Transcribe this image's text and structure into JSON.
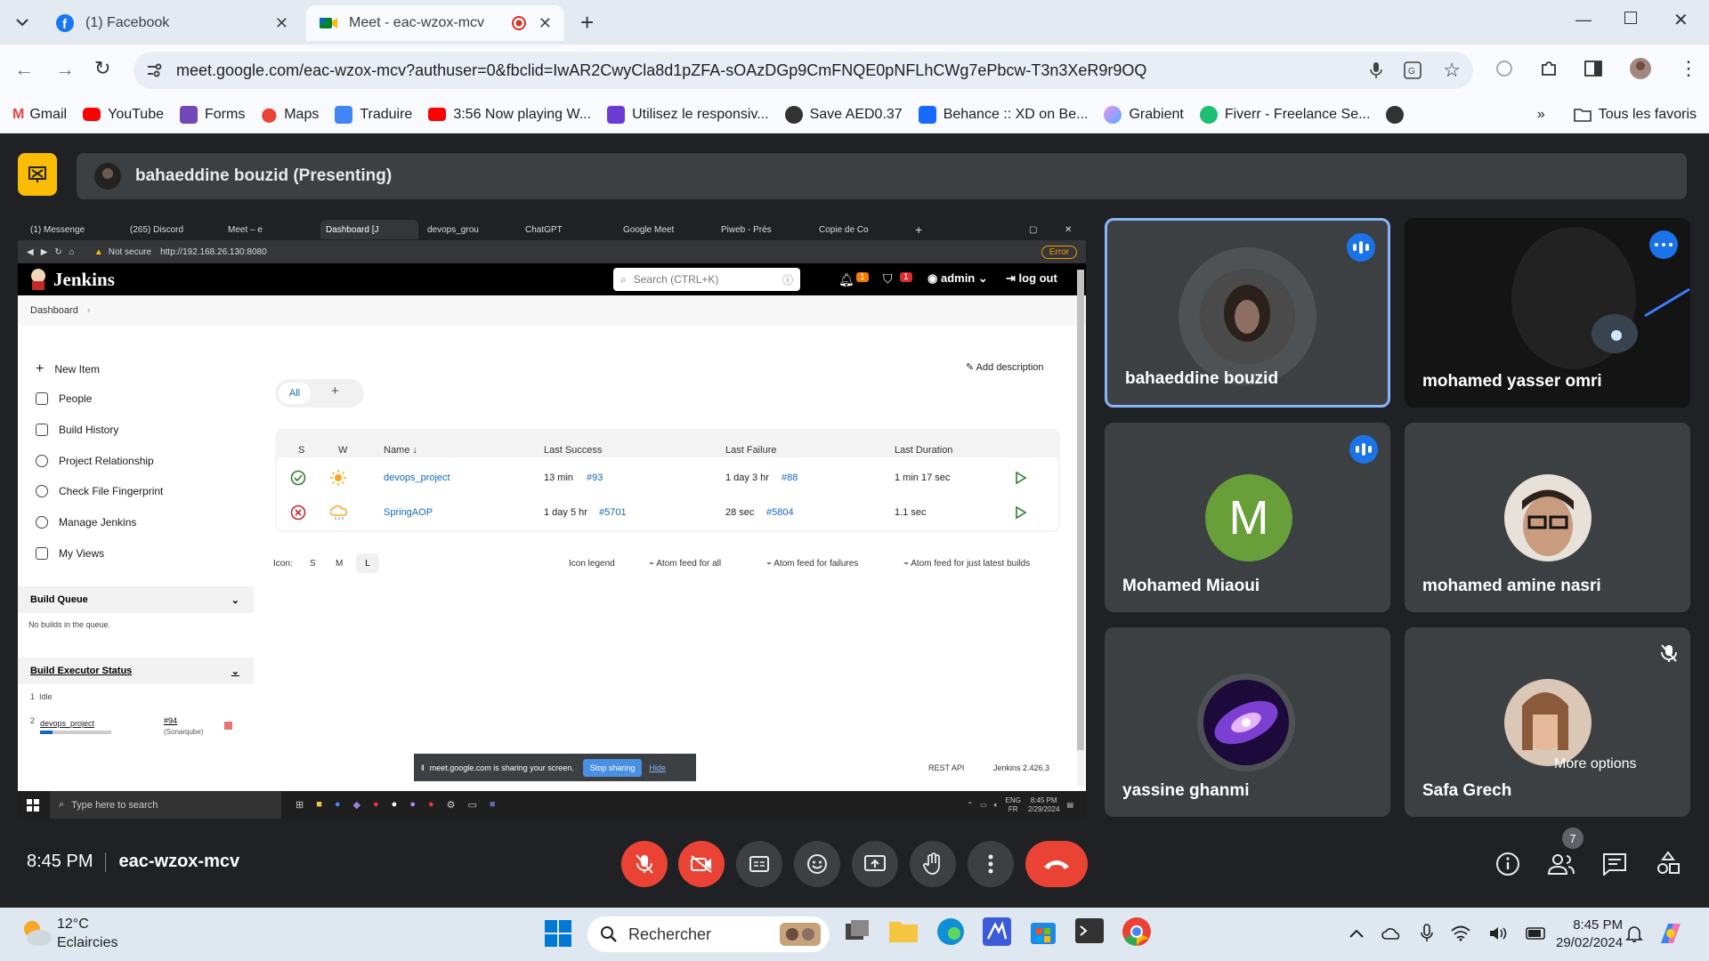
{
  "browser": {
    "tabs": [
      {
        "label": "(1) Facebook",
        "active": false
      },
      {
        "label": "Meet - eac-wzox-mcv",
        "active": true
      }
    ],
    "url": "meet.google.com/eac-wzox-mcv?authuser=0&fbclid=IwAR2CwyCla8d1pZFA-sOAzDGp9CmFNQE0pNFLhCWg7ePbcw-T3n3XeR9r9OQ",
    "bookmarks": [
      "Gmail",
      "YouTube",
      "Forms",
      "Maps",
      "Traduire",
      "3:56 Now playing W...",
      "Utilisez le responsiv...",
      "Save AED0.37",
      "Behance :: XD on Be...",
      "Grabient",
      "Fiverr - Freelance Se..."
    ],
    "all_bookmarks": "Tous les favoris"
  },
  "meet": {
    "presenter_label": "bahaeddine bouzid (Presenting)",
    "time": "8:45 PM",
    "meeting_code": "eac-wzox-mcv",
    "participant_count": "7",
    "participants": [
      {
        "name": "bahaeddine bouzid",
        "speaking": true
      },
      {
        "name": "mohamed yasser omri",
        "speaking": true
      },
      {
        "name": "Mohamed Miaoui",
        "initial": "M",
        "speaking": true
      },
      {
        "name": "mohamed amine nasri",
        "speaking": false
      },
      {
        "name": "yassine ghanmi",
        "speaking": false
      },
      {
        "name": "Safa Grech",
        "muted": true
      }
    ],
    "more_options": "More options",
    "accent": "#1a73e8",
    "danger": "#ea4335"
  },
  "shared": {
    "tabs": [
      "(1) Messenge",
      "(265) Discord",
      "Meet – e",
      "Dashboard [J",
      "devops_grou",
      "ChatGPT",
      "Google Meet",
      "Piweb - Prés",
      "Copie de Co"
    ],
    "not_secure": "Not secure",
    "url": "http://192.168.26.130:8080",
    "error_badge": "Error",
    "jenkins": {
      "brand": "Jenkins",
      "search_placeholder": "Search (CTRL+K)",
      "notif_count": "1",
      "security_count": "1",
      "user": "admin",
      "logout": "log out",
      "breadcrumb": "Dashboard",
      "sidebar": [
        "New Item",
        "People",
        "Build History",
        "Project Relationship",
        "Check File Fingerprint",
        "Manage Jenkins",
        "My Views"
      ],
      "build_queue_title": "Build Queue",
      "build_queue_empty": "No builds in the queue.",
      "executor_title": "Build Executor Status",
      "executor_idle": "Idle",
      "executor_idle_num": "1",
      "executor_job_num": "2",
      "executor_job": "devops_project",
      "executor_build": "#94",
      "executor_stage": "(Sonarqube)",
      "add_description": "Add description",
      "view_tab_all": "All",
      "view_tab_add": "+",
      "columns": [
        "S",
        "W",
        "Name ↓",
        "Last Success",
        "Last Failure",
        "Last Duration"
      ],
      "rows": [
        {
          "status": "success",
          "weather": "sunny",
          "name": "devops_project",
          "last_success": "13 min",
          "last_success_build": "#93",
          "last_failure": "1 day 3 hr",
          "last_failure_build": "#88",
          "duration": "1 min 17 sec"
        },
        {
          "status": "failed",
          "weather": "cloudy",
          "name": "SpringAOP",
          "last_success": "1 day 5 hr",
          "last_success_build": "#5701",
          "last_failure": "28 sec",
          "last_failure_build": "#5804",
          "duration": "1.1 sec"
        }
      ],
      "icon_label": "Icon:",
      "icon_sizes": [
        "S",
        "M",
        "L"
      ],
      "icon_legend": "Icon legend",
      "feeds": [
        "Atom feed for all",
        "Atom feed for failures",
        "Atom feed for just latest builds"
      ],
      "sharing_text": "meet.google.com is sharing your screen.",
      "stop_sharing": "Stop sharing",
      "hide": "Hide",
      "rest_api": "REST API",
      "version": "Jenkins 2.426.3"
    },
    "taskbar": {
      "search": "Type here to search",
      "lang": "ENG",
      "lang2": "FR",
      "time": "8:45 PM",
      "date": "2/29/2024"
    }
  },
  "windows": {
    "weather_temp": "12°C",
    "weather_desc": "Eclaircies",
    "search": "Rechercher",
    "time": "8:45 PM",
    "date": "29/02/2024"
  }
}
